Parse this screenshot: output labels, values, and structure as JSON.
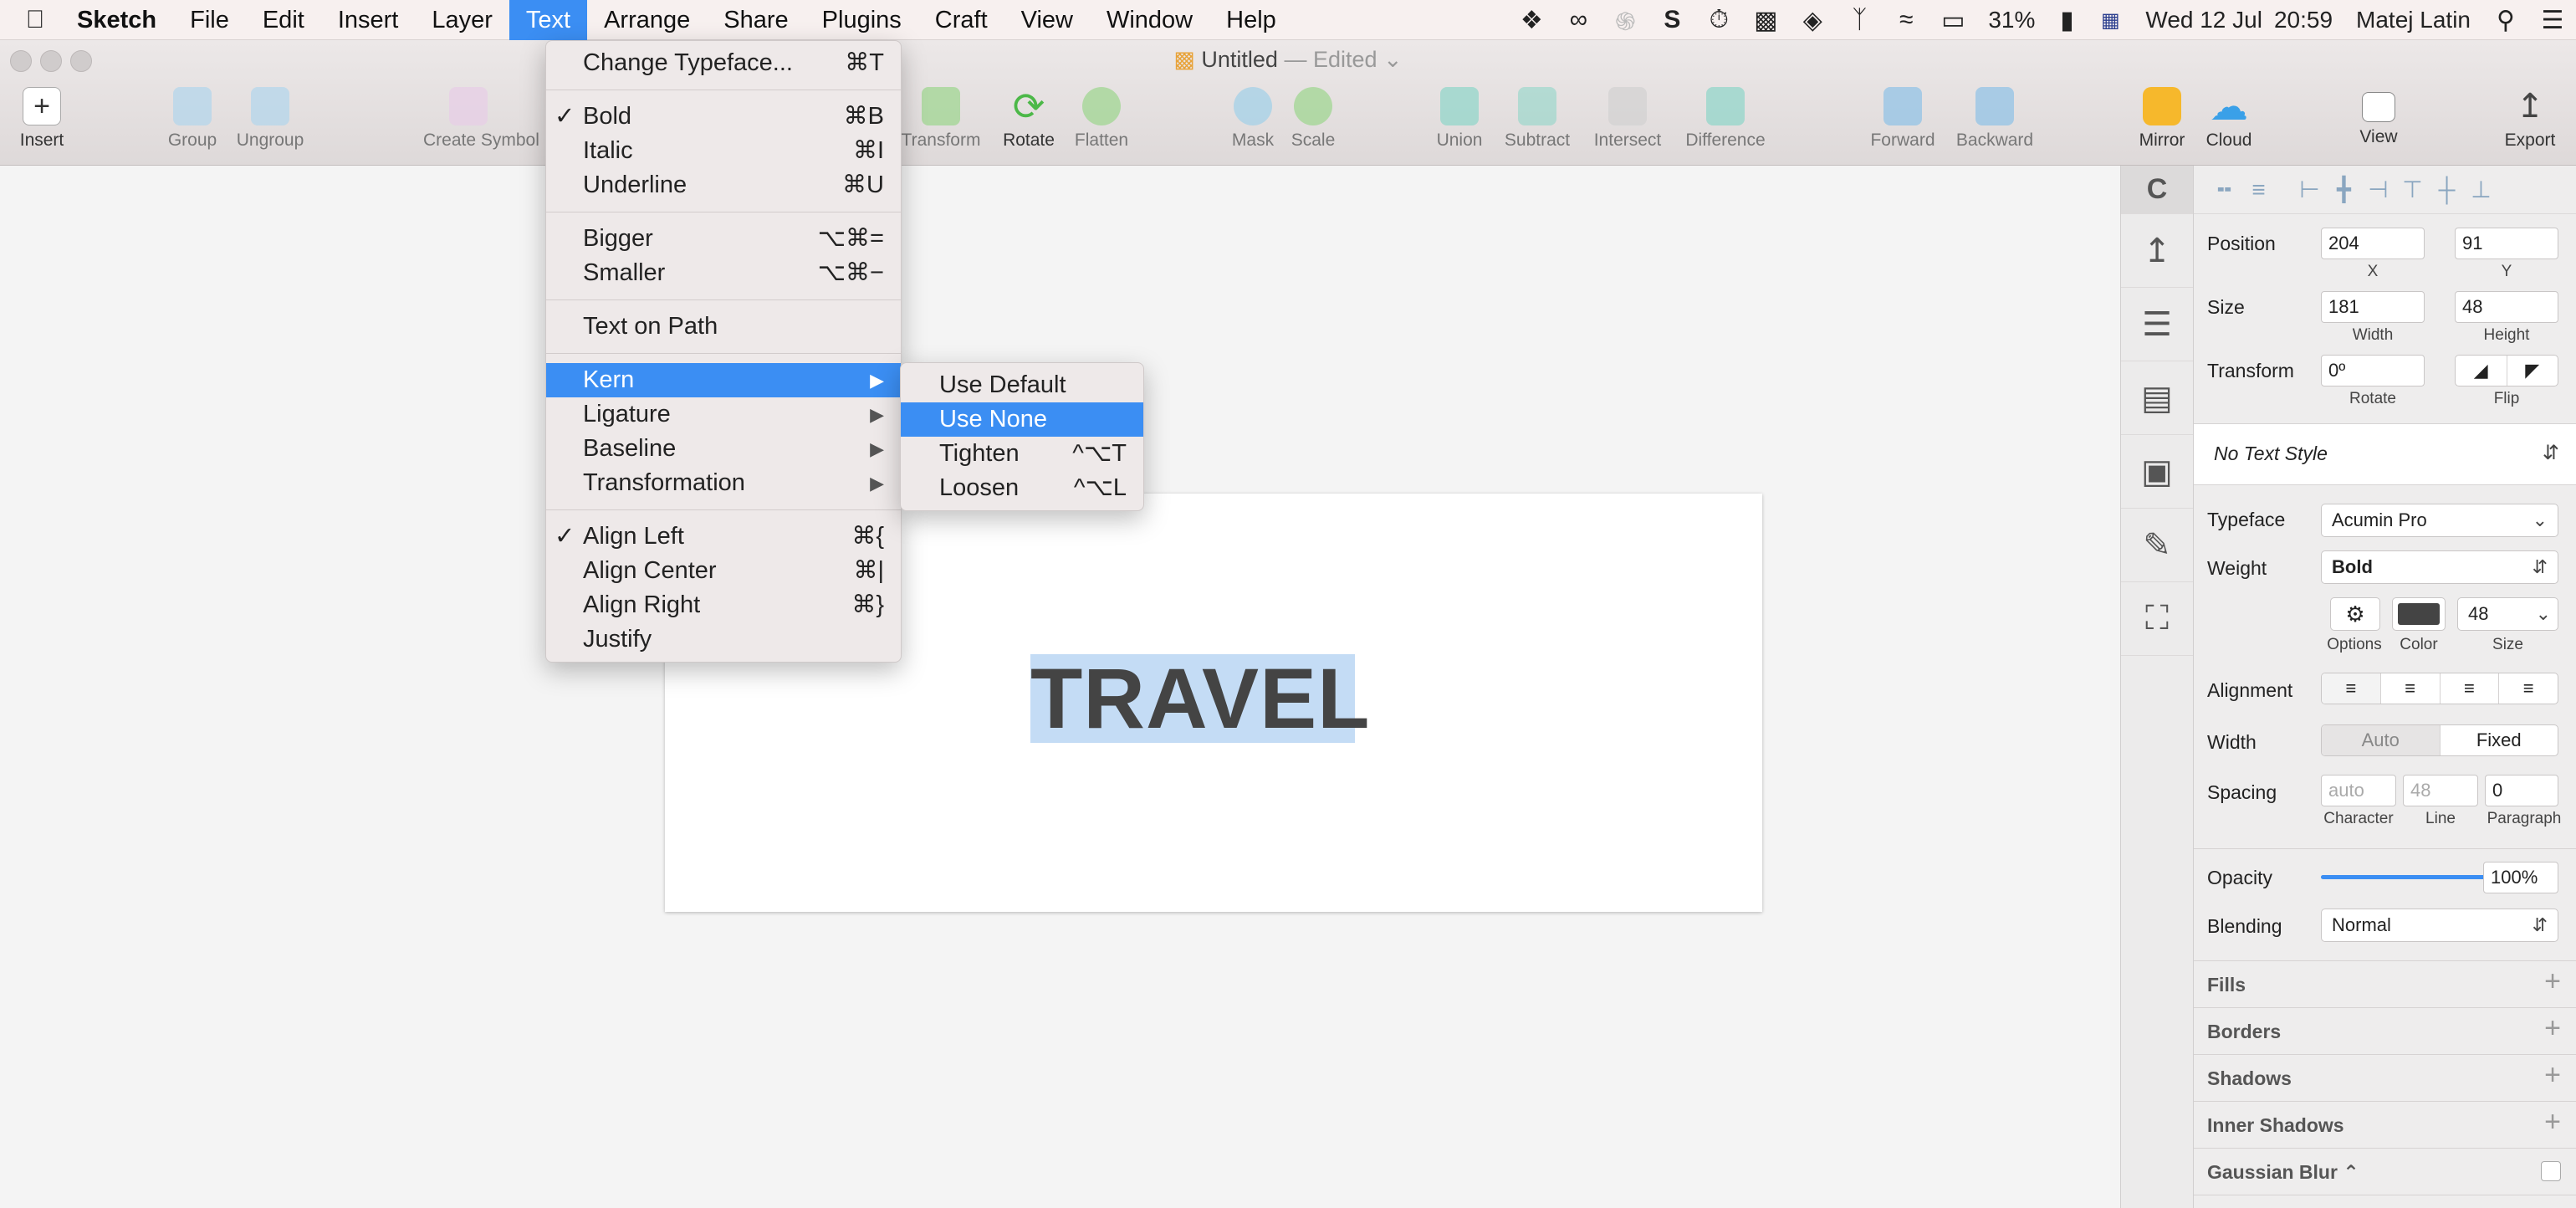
{
  "menubar": {
    "app": "Sketch",
    "items": [
      "File",
      "Edit",
      "Insert",
      "Layer",
      "Text",
      "Arrange",
      "Share",
      "Plugins",
      "Craft",
      "View",
      "Window",
      "Help"
    ],
    "active": "Text",
    "status": {
      "battery": "31%",
      "date": "Wed 12 Jul",
      "time": "20:59",
      "user": "Matej Latin"
    }
  },
  "window": {
    "title": "Untitled",
    "edited": "— Edited"
  },
  "toolbar": {
    "items": [
      {
        "label": "Insert"
      },
      {
        "label": "Group"
      },
      {
        "label": "Ungroup"
      },
      {
        "label": "Create Symbol"
      },
      {
        "label": "Transform"
      },
      {
        "label": "Rotate"
      },
      {
        "label": "Flatten"
      },
      {
        "label": "Mask"
      },
      {
        "label": "Scale"
      },
      {
        "label": "Union"
      },
      {
        "label": "Subtract"
      },
      {
        "label": "Intersect"
      },
      {
        "label": "Difference"
      },
      {
        "label": "Forward"
      },
      {
        "label": "Backward"
      },
      {
        "label": "Mirror"
      },
      {
        "label": "Cloud"
      },
      {
        "label": "View"
      },
      {
        "label": "Export"
      }
    ]
  },
  "canvas": {
    "text": "TRAVEL"
  },
  "text_menu": {
    "items": [
      {
        "label": "Change Typeface...",
        "shortcut": "⌘T"
      },
      {
        "label": "Bold",
        "shortcut": "⌘B",
        "checked": "✓"
      },
      {
        "label": "Italic",
        "shortcut": "⌘I"
      },
      {
        "label": "Underline",
        "shortcut": "⌘U"
      },
      {
        "label": "Bigger",
        "shortcut": "⌥⌘="
      },
      {
        "label": "Smaller",
        "shortcut": "⌥⌘−"
      },
      {
        "label": "Text on Path",
        "shortcut": ""
      },
      {
        "label": "Kern",
        "shortcut": "▶"
      },
      {
        "label": "Ligature",
        "shortcut": "▶"
      },
      {
        "label": "Baseline",
        "shortcut": "▶"
      },
      {
        "label": "Transformation",
        "shortcut": "▶"
      },
      {
        "label": "Align Left",
        "shortcut": "⌘{",
        "checked": "✓"
      },
      {
        "label": "Align Center",
        "shortcut": "⌘|"
      },
      {
        "label": "Align Right",
        "shortcut": "⌘}"
      },
      {
        "label": "Justify",
        "shortcut": ""
      }
    ]
  },
  "kern_menu": {
    "items": [
      {
        "label": "Use Default",
        "shortcut": ""
      },
      {
        "label": "Use None",
        "shortcut": ""
      },
      {
        "label": "Tighten",
        "shortcut": "^⌥T"
      },
      {
        "label": "Loosen",
        "shortcut": "^⌥L"
      }
    ]
  },
  "inspector": {
    "position": {
      "label": "Position",
      "x": "204",
      "y": "91",
      "x_label": "X",
      "y_label": "Y"
    },
    "size": {
      "label": "Size",
      "w": "181",
      "h": "48",
      "w_label": "Width",
      "h_label": "Height"
    },
    "transform": {
      "label": "Transform",
      "rotate": "0º",
      "rotate_label": "Rotate",
      "flip_label": "Flip"
    },
    "text_style": "No Text Style",
    "typeface": {
      "label": "Typeface",
      "value": "Acumin Pro"
    },
    "weight": {
      "label": "Weight",
      "value": "Bold"
    },
    "options_label": "Options",
    "color_label": "Color",
    "font_size": {
      "value": "48",
      "label": "Size"
    },
    "alignment_label": "Alignment",
    "width": {
      "label": "Width",
      "auto": "Auto",
      "fixed": "Fixed"
    },
    "spacing": {
      "label": "Spacing",
      "character": "auto",
      "line": "48",
      "paragraph": "0",
      "character_label": "Character",
      "line_label": "Line",
      "paragraph_label": "Paragraph"
    },
    "opacity": {
      "label": "Opacity",
      "value": "100%",
      "level": 1.0
    },
    "blending": {
      "label": "Blending",
      "value": "Normal"
    },
    "sections": [
      "Fills",
      "Borders",
      "Shadows",
      "Inner Shadows",
      "Gaussian Blur ⌃"
    ]
  },
  "colors": {
    "accent": "#3b8ef3",
    "selection": "#c4dcf5",
    "text": "#444444"
  }
}
